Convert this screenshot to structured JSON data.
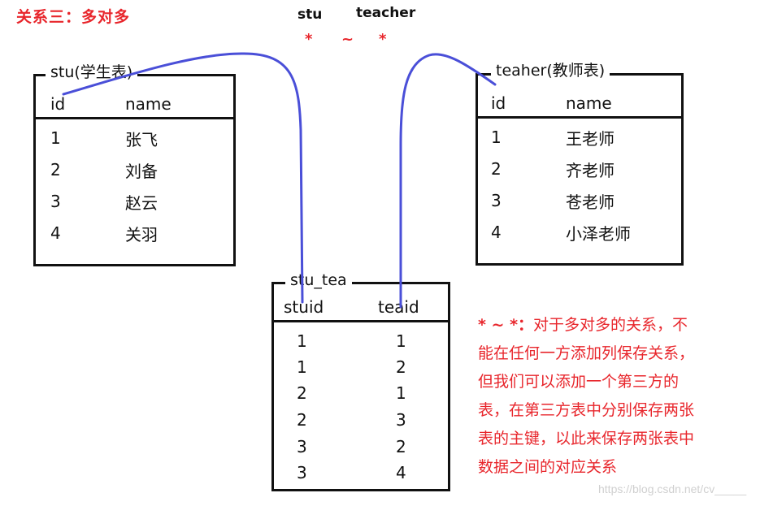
{
  "title": "关系三：多对多",
  "relation": {
    "left_entity": "stu",
    "right_entity": "teacher",
    "left_mult": "*",
    "connector": "~",
    "right_mult": "*"
  },
  "tables": {
    "stu": {
      "caption": "stu(学生表)",
      "columns": [
        "id",
        "name"
      ],
      "rows": [
        [
          "1",
          "张飞"
        ],
        [
          "2",
          "刘备"
        ],
        [
          "3",
          "赵云"
        ],
        [
          "4",
          "关羽"
        ]
      ]
    },
    "teacher": {
      "caption": "teaher(教师表)",
      "columns": [
        "id",
        "name"
      ],
      "rows": [
        [
          "1",
          "王老师"
        ],
        [
          "2",
          "齐老师"
        ],
        [
          "3",
          "苍老师"
        ],
        [
          "4",
          "小泽老师"
        ]
      ]
    },
    "stu_tea": {
      "caption": "stu_tea",
      "columns": [
        "stuid",
        "teaid"
      ],
      "rows": [
        [
          "1",
          "1"
        ],
        [
          "1",
          "2"
        ],
        [
          "2",
          "1"
        ],
        [
          "2",
          "3"
        ],
        [
          "3",
          "2"
        ],
        [
          "3",
          "4"
        ]
      ]
    }
  },
  "note": {
    "lead": "* ~ *：",
    "lines": [
      "对于多对多的关系，不",
      "能在任何一方添加列保存关系，",
      "但我们可以添加一个第三方的",
      "表，在第三方表中分别保存两张",
      "表的主键，以此来保存两张表中",
      "数据之间的对应关系"
    ]
  },
  "watermark": "https://blog.csdn.net/cv_____",
  "colors": {
    "accent_red": "#e8262c",
    "connector_blue": "#4a4fd8",
    "border": "#111111"
  }
}
